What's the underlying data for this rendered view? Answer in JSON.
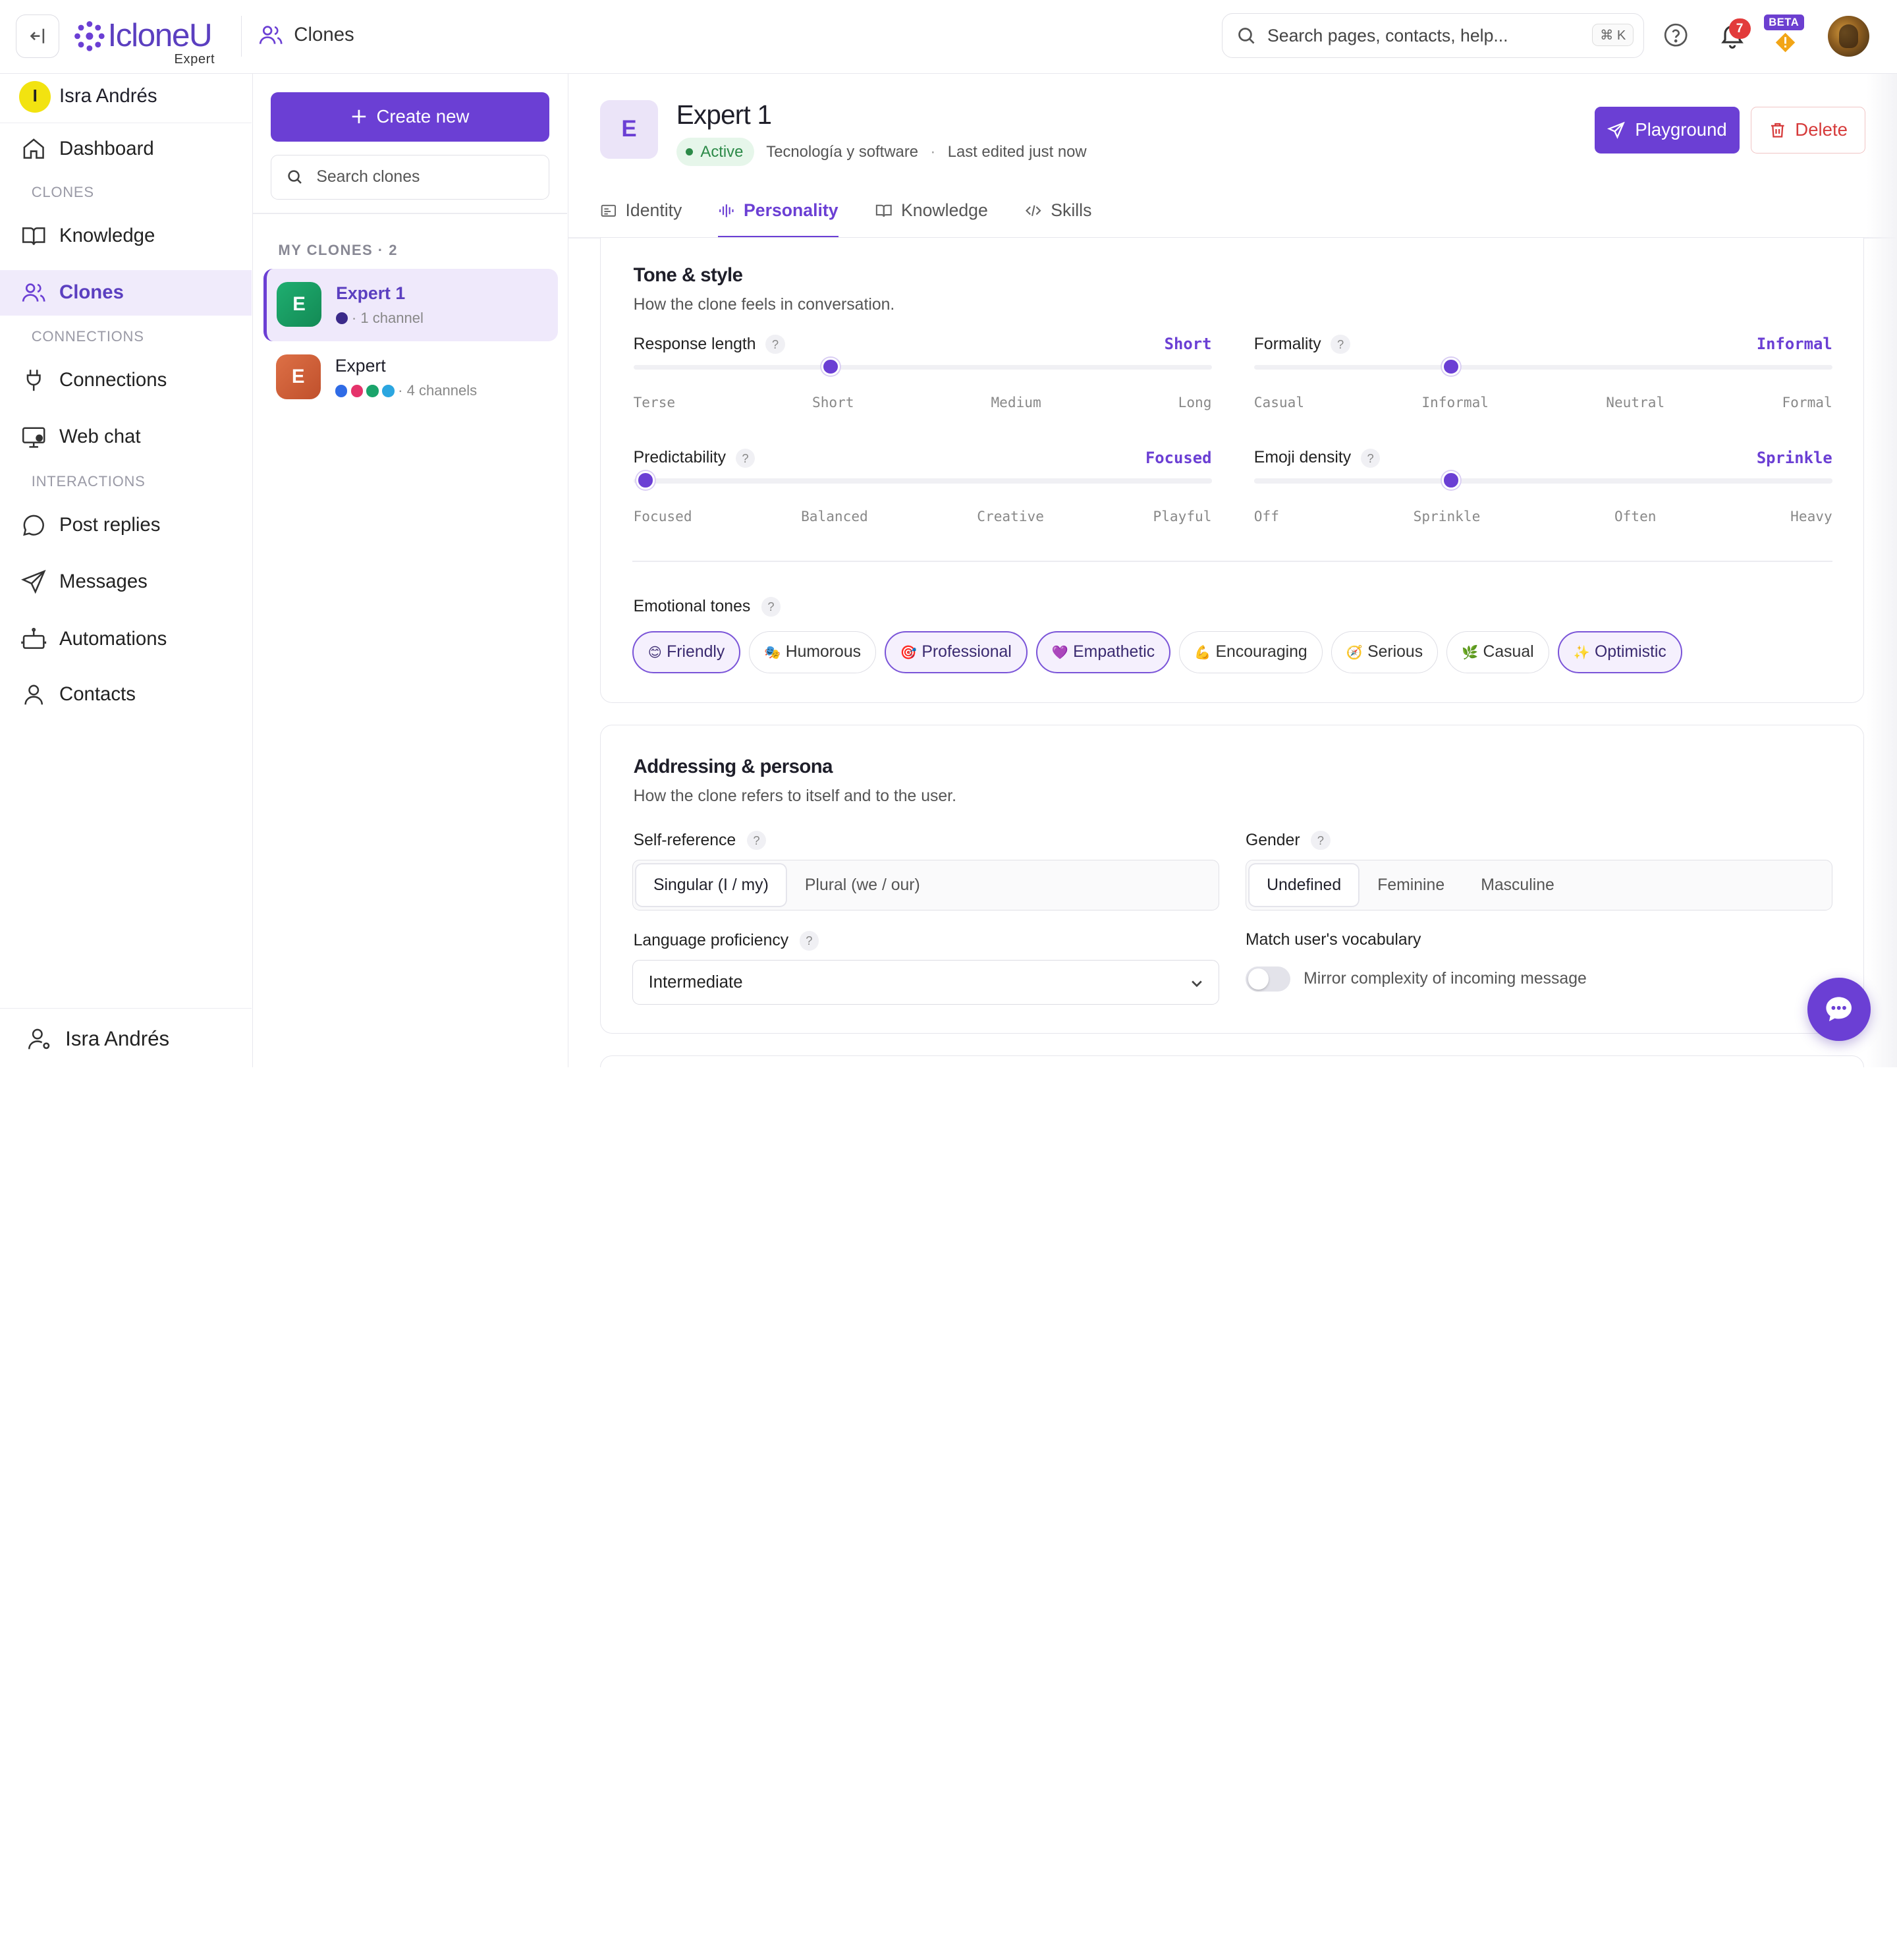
{
  "header": {
    "logo_text": "IcloneU",
    "logo_sub": "Expert",
    "section": "Clones",
    "search_placeholder": "Search pages, contacts, help...",
    "search_kbd": "⌘ K",
    "notification_count": "7",
    "beta_label": "BETA"
  },
  "sidebar": {
    "user_initial": "I",
    "user_name": "Isra Andrés",
    "dashboard": "Dashboard",
    "section_clones": "CLONES",
    "knowledge": "Knowledge",
    "clones": "Clones",
    "section_connections": "CONNECTIONS",
    "connections": "Connections",
    "web_chat": "Web chat",
    "section_interactions": "INTERACTIONS",
    "post_replies": "Post replies",
    "messages": "Messages",
    "automations": "Automations",
    "contacts": "Contacts",
    "footer_name": "Isra Andrés"
  },
  "clones_panel": {
    "create_label": "Create new",
    "search_placeholder": "Search clones",
    "section": "MY CLONES · 2",
    "items": [
      {
        "initial": "E",
        "name": "Expert 1",
        "meta": "· 1 channel",
        "color": "#1a9a62",
        "dots": [
          "#3b2a8a"
        ]
      },
      {
        "initial": "E",
        "name": "Expert",
        "meta": "· 4 channels",
        "color": "#d0623b",
        "dots": [
          "#2f6be6",
          "#e5336b",
          "#1aa46b",
          "#2ba6e0"
        ]
      }
    ]
  },
  "main": {
    "avatar_initial": "E",
    "title": "Expert 1",
    "status": "Active",
    "category": "Tecnología y software",
    "sep": "·",
    "last_edited": "Last edited just now",
    "playground_label": "Playground",
    "delete_label": "Delete",
    "tabs": [
      "Identity",
      "Personality",
      "Knowledge",
      "Skills"
    ]
  },
  "tone_card": {
    "title": "Tone & style",
    "subtitle": "How the clone feels in conversation.",
    "sliders": [
      {
        "label": "Response length",
        "value": "Short",
        "ticks": [
          "Terse",
          "Short",
          "Medium",
          "Long"
        ],
        "level": 0.34
      },
      {
        "label": "Formality",
        "value": "Informal",
        "ticks": [
          "Casual",
          "Informal",
          "Neutral",
          "Formal"
        ],
        "level": 0.34
      },
      {
        "label": "Predictability",
        "value": "Focused",
        "ticks": [
          "Focused",
          "Balanced",
          "Creative",
          "Playful"
        ],
        "level": 0.02
      },
      {
        "label": "Emoji density",
        "value": "Sprinkle",
        "ticks": [
          "Off",
          "Sprinkle",
          "Often",
          "Heavy"
        ],
        "level": 0.34
      }
    ],
    "tones_label": "Emotional tones",
    "chips": [
      {
        "emoji": "😊",
        "label": "Friendly",
        "on": true
      },
      {
        "emoji": "🎭",
        "label": "Humorous",
        "on": false
      },
      {
        "emoji": "🎯",
        "label": "Professional",
        "on": true
      },
      {
        "emoji": "💜",
        "label": "Empathetic",
        "on": true
      },
      {
        "emoji": "💪",
        "label": "Encouraging",
        "on": false
      },
      {
        "emoji": "🧭",
        "label": "Serious",
        "on": false
      },
      {
        "emoji": "🌿",
        "label": "Casual",
        "on": false
      },
      {
        "emoji": "✨",
        "label": "Optimistic",
        "on": true
      }
    ]
  },
  "persona_card": {
    "title": "Addressing & persona",
    "subtitle": "How the clone refers to itself and to the user.",
    "self_reference_label": "Self-reference",
    "self_reference_options": [
      "Singular (I / my)",
      "Plural (we / our)"
    ],
    "gender_label": "Gender",
    "gender_options": [
      "Undefined",
      "Feminine",
      "Masculine"
    ],
    "proficiency_label": "Language proficiency",
    "proficiency_value": "Intermediate",
    "vocab_label": "Match user's vocabulary",
    "vocab_desc": "Mirror complexity of incoming message",
    "q": "?"
  }
}
